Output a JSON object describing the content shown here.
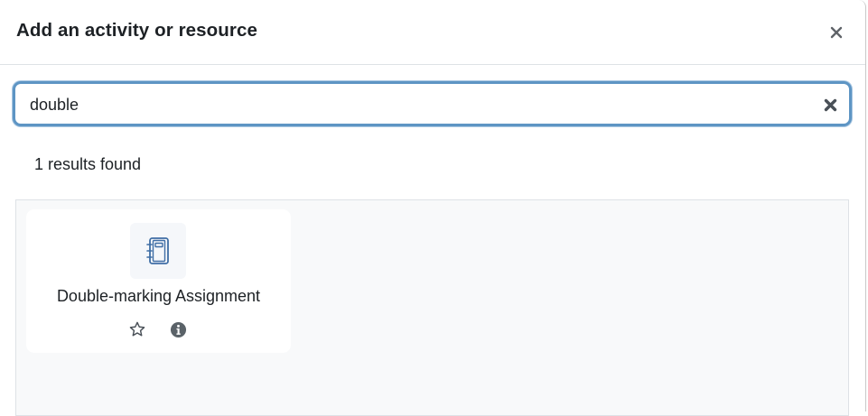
{
  "modal": {
    "title": "Add an activity or resource",
    "close_icon": "close-icon"
  },
  "search": {
    "value": "double",
    "clear_icon": "clear-search-icon"
  },
  "results": {
    "count_text": "1 results found",
    "items": [
      {
        "label": "Double-marking Assignment",
        "icon": "assignment-notebook-icon",
        "star_icon": "star-outline-icon",
        "info_icon": "info-icon"
      }
    ]
  },
  "colors": {
    "focus_border": "#5e95c4",
    "results_bg": "#f8f9fa",
    "icon_blue": "#3f6ea5",
    "text": "#1d2125"
  }
}
